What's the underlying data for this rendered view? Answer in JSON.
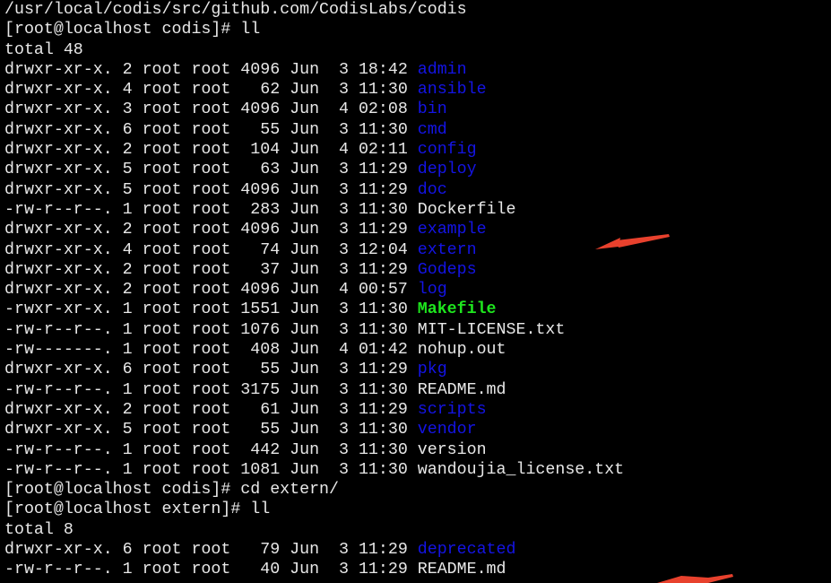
{
  "terminal": {
    "colors": {
      "background": "#000000",
      "text": "#e8e8e8",
      "directory": "#1414e6",
      "executable": "#1ee61e",
      "annotation_arrow": "#e8412d"
    },
    "lines": [
      {
        "segments": [
          {
            "text": "/usr/local/codis/src/github.com/CodisLabs/codis",
            "color": "white"
          }
        ]
      },
      {
        "segments": [
          {
            "text": "[root@localhost codis]# ll",
            "color": "white"
          }
        ]
      },
      {
        "segments": [
          {
            "text": "total 48",
            "color": "white"
          }
        ]
      },
      {
        "segments": [
          {
            "text": "drwxr-xr-x. 2 root root 4096 Jun  3 18:42 ",
            "color": "white"
          },
          {
            "text": "admin",
            "color": "blue"
          }
        ]
      },
      {
        "segments": [
          {
            "text": "drwxr-xr-x. 4 root root   62 Jun  3 11:30 ",
            "color": "white"
          },
          {
            "text": "ansible",
            "color": "blue"
          }
        ]
      },
      {
        "segments": [
          {
            "text": "drwxr-xr-x. 3 root root 4096 Jun  4 02:08 ",
            "color": "white"
          },
          {
            "text": "bin",
            "color": "blue"
          }
        ]
      },
      {
        "segments": [
          {
            "text": "drwxr-xr-x. 6 root root   55 Jun  3 11:30 ",
            "color": "white"
          },
          {
            "text": "cmd",
            "color": "blue"
          }
        ]
      },
      {
        "segments": [
          {
            "text": "drwxr-xr-x. 2 root root  104 Jun  4 02:11 ",
            "color": "white"
          },
          {
            "text": "config",
            "color": "blue"
          }
        ]
      },
      {
        "segments": [
          {
            "text": "drwxr-xr-x. 5 root root   63 Jun  3 11:29 ",
            "color": "white"
          },
          {
            "text": "deploy",
            "color": "blue"
          }
        ]
      },
      {
        "segments": [
          {
            "text": "drwxr-xr-x. 5 root root 4096 Jun  3 11:29 ",
            "color": "white"
          },
          {
            "text": "doc",
            "color": "blue"
          }
        ]
      },
      {
        "segments": [
          {
            "text": "-rw-r--r--. 1 root root  283 Jun  3 11:30 Dockerfile",
            "color": "white"
          }
        ]
      },
      {
        "segments": [
          {
            "text": "drwxr-xr-x. 2 root root 4096 Jun  3 11:29 ",
            "color": "white"
          },
          {
            "text": "example",
            "color": "blue"
          }
        ]
      },
      {
        "segments": [
          {
            "text": "drwxr-xr-x. 4 root root   74 Jun  3 12:04 ",
            "color": "white"
          },
          {
            "text": "extern",
            "color": "blue"
          }
        ]
      },
      {
        "segments": [
          {
            "text": "drwxr-xr-x. 2 root root   37 Jun  3 11:29 ",
            "color": "white"
          },
          {
            "text": "Godeps",
            "color": "blue"
          }
        ]
      },
      {
        "segments": [
          {
            "text": "drwxr-xr-x. 2 root root 4096 Jun  4 00:57 ",
            "color": "white"
          },
          {
            "text": "log",
            "color": "blue"
          }
        ]
      },
      {
        "segments": [
          {
            "text": "-rwxr-xr-x. 1 root root 1551 Jun  3 11:30 ",
            "color": "white"
          },
          {
            "text": "Makefile",
            "color": "green"
          }
        ]
      },
      {
        "segments": [
          {
            "text": "-rw-r--r--. 1 root root 1076 Jun  3 11:30 MIT-LICENSE.txt",
            "color": "white"
          }
        ]
      },
      {
        "segments": [
          {
            "text": "-rw-------. 1 root root  408 Jun  4 01:42 nohup.out",
            "color": "white"
          }
        ]
      },
      {
        "segments": [
          {
            "text": "drwxr-xr-x. 6 root root   55 Jun  3 11:29 ",
            "color": "white"
          },
          {
            "text": "pkg",
            "color": "blue"
          }
        ]
      },
      {
        "segments": [
          {
            "text": "-rw-r--r--. 1 root root 3175 Jun  3 11:30 README.md",
            "color": "white"
          }
        ]
      },
      {
        "segments": [
          {
            "text": "drwxr-xr-x. 2 root root   61 Jun  3 11:29 ",
            "color": "white"
          },
          {
            "text": "scripts",
            "color": "blue"
          }
        ]
      },
      {
        "segments": [
          {
            "text": "drwxr-xr-x. 5 root root   55 Jun  3 11:30 ",
            "color": "white"
          },
          {
            "text": "vendor",
            "color": "blue"
          }
        ]
      },
      {
        "segments": [
          {
            "text": "-rw-r--r--. 1 root root  442 Jun  3 11:30 version",
            "color": "white"
          }
        ]
      },
      {
        "segments": [
          {
            "text": "-rw-r--r--. 1 root root 1081 Jun  3 11:30 wandoujia_license.txt",
            "color": "white"
          }
        ]
      },
      {
        "segments": [
          {
            "text": "[root@localhost codis]# cd extern/",
            "color": "white"
          }
        ]
      },
      {
        "segments": [
          {
            "text": "[root@localhost extern]# ll",
            "color": "white"
          }
        ]
      },
      {
        "segments": [
          {
            "text": "total 8",
            "color": "white"
          }
        ]
      },
      {
        "segments": [
          {
            "text": "drwxr-xr-x. 6 root root   79 Jun  3 11:29 ",
            "color": "white"
          },
          {
            "text": "deprecated",
            "color": "blue"
          }
        ]
      },
      {
        "segments": [
          {
            "text": "-rw-r--r--. 1 root root   40 Jun  3 11:29 README.md",
            "color": "white"
          }
        ]
      }
    ]
  },
  "annotations": [
    {
      "type": "arrow",
      "points_to": "extern",
      "color": "red"
    },
    {
      "type": "arrow",
      "points_to": "README.md",
      "color": "red"
    }
  ]
}
